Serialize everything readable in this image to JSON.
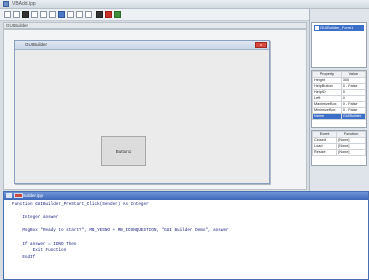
{
  "window": {
    "title": "VBAdd.ipp"
  },
  "toolbar": {
    "buttons": [
      "new",
      "open",
      "save",
      "cut",
      "copy",
      "paste",
      "run",
      "stop",
      "debug",
      "form",
      "grid",
      "color",
      "close"
    ]
  },
  "tab": {
    "label": "GUIBuilder"
  },
  "form": {
    "title": "GUIBuilder",
    "close": "x",
    "button_label": "Button1"
  },
  "explorer": {
    "selected": "GUIBuilder_Form1"
  },
  "properties": {
    "headers": [
      "Property",
      "Value"
    ],
    "rows": [
      [
        "Height",
        "300"
      ],
      [
        "HelpButton",
        "0 - False"
      ],
      [
        "HelpID",
        "0"
      ],
      [
        "Left",
        "0"
      ],
      [
        "MaximizeBox",
        "0 - False"
      ],
      [
        "MinimizeBox",
        "0 - False"
      ],
      [
        "Name",
        "GUIBuilder"
      ]
    ]
  },
  "events": {
    "headers": [
      "Event",
      "Function"
    ],
    "rows": [
      [
        "Closed",
        "[None]"
      ],
      [
        "Load",
        "[None]"
      ],
      [
        "Resize",
        "[None]"
      ]
    ]
  },
  "editor": {
    "title": "GUIBuilder.ipp",
    "lines": [
      "Function GUIBuilder_PreStart_Click(Sender) As Integer",
      "",
      "    Integer answer",
      "",
      "    MsgBox \"Ready to start?\", MB_YESNO + MB_ICONQUESTION, \"GUI Builder Demo\", answer",
      "",
      "    If answer = IDNO Then",
      "        Exit Function",
      "    EndIf"
    ]
  }
}
